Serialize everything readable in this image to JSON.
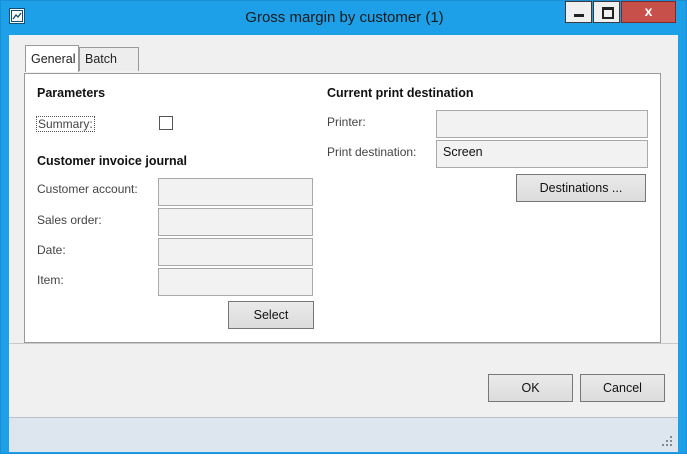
{
  "window": {
    "title": "Gross margin by customer (1)",
    "close_glyph": "x",
    "colors": {
      "titlebar": "#1ea0e8",
      "close_button": "#c7504a",
      "client": "#f0f0f0",
      "statusbar": "#dde6ee"
    }
  },
  "tabs": [
    {
      "label": "General",
      "active": true
    },
    {
      "label": "Batch",
      "active": false
    }
  ],
  "parameters": {
    "heading": "Parameters",
    "summary_label": "Summary:",
    "summary_checked": false
  },
  "customer_invoice_journal": {
    "heading": "Customer invoice journal",
    "customer_account_label": "Customer account:",
    "customer_account_value": "",
    "sales_order_label": "Sales order:",
    "sales_order_value": "",
    "date_label": "Date:",
    "date_value": "",
    "item_label": "Item:",
    "item_value": "",
    "select_button": "Select"
  },
  "print_destination": {
    "heading": "Current print destination",
    "printer_label": "Printer:",
    "printer_value": "",
    "destination_label": "Print destination:",
    "destination_value": "Screen",
    "destinations_button": "Destinations ..."
  },
  "footer": {
    "ok_button": "OK",
    "cancel_button": "Cancel"
  },
  "icons": {
    "app": "report-icon",
    "minimize": "minimize-icon",
    "maximize": "maximize-icon",
    "close": "close-icon",
    "resize": "resize-grip-icon"
  }
}
